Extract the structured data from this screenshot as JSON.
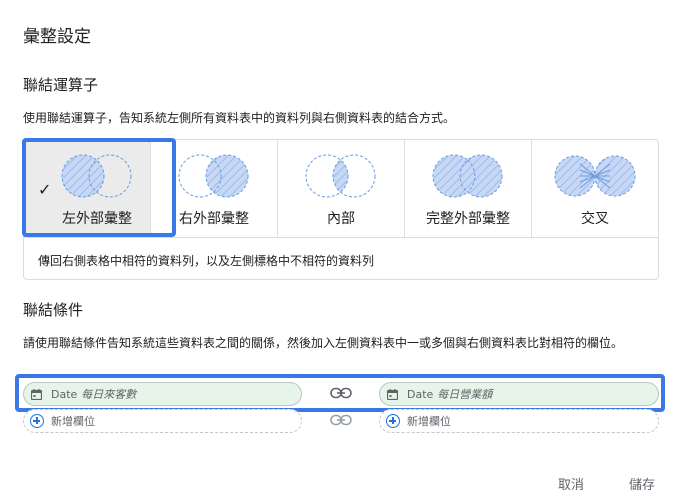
{
  "dialog": {
    "title": "彙整設定"
  },
  "join_operator": {
    "heading": "聯結運算子",
    "description": "使用聯結運算子，告知系統左側所有資料表中的資料列與右側資料表的結合方式。",
    "options": [
      {
        "label": "左外部彙整",
        "selected": true
      },
      {
        "label": "右外部彙整",
        "selected": false
      },
      {
        "label": "內部",
        "selected": false
      },
      {
        "label": "完整外部彙整",
        "selected": false
      },
      {
        "label": "交叉",
        "selected": false
      }
    ],
    "selected_description": "傳回右側表格中相符的資料列，以及左側標格中不相符的資料列"
  },
  "join_conditions": {
    "heading": "聯結條件",
    "description": "請使用聯結條件告知系統這些資料表之間的關係，然後加入左側資料表中一或多個與右側資料表比對相符的欄位。",
    "left_field": {
      "type": "Date",
      "name": "每日來客數"
    },
    "right_field": {
      "type": "Date",
      "name": "每日營業額"
    },
    "add_field_left": "新增欄位",
    "add_field_right": "新增欄位"
  },
  "footer": {
    "cancel": "取消",
    "save": "儲存"
  },
  "colors": {
    "accent": "#3b78e7",
    "venn_fill": "#c6d8f5",
    "venn_stroke": "#6c9be0",
    "field_bg": "#e6f4ea"
  }
}
